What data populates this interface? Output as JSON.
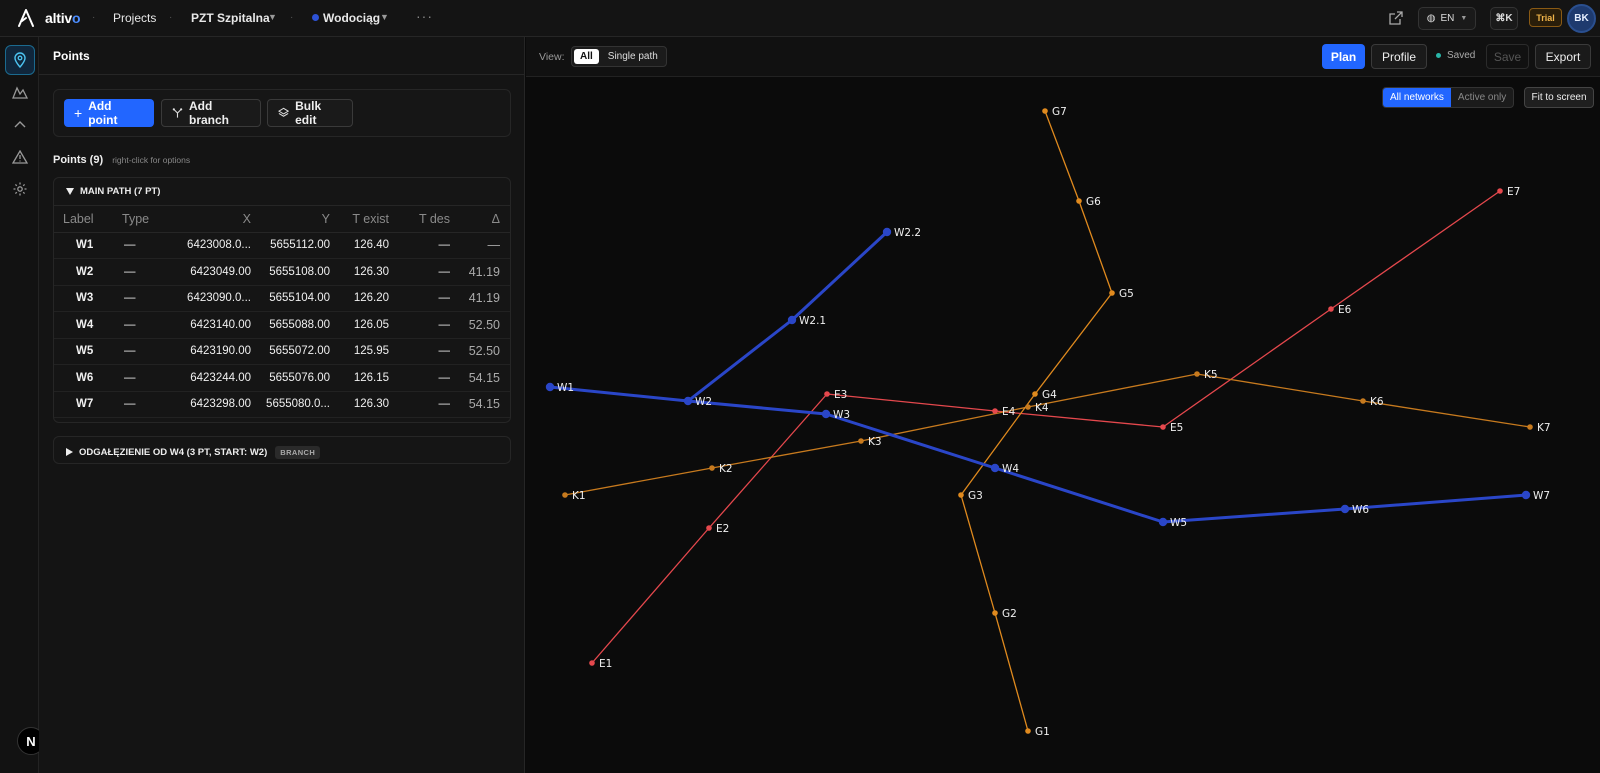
{
  "app": {
    "logo_text": "altiv",
    "logo_accent": "o"
  },
  "breadcrumb": {
    "projects": "Projects",
    "project": "PZT Szpitalna",
    "network": "Wodociąg"
  },
  "topbar": {
    "lang": "EN",
    "shortcut": "⌘K",
    "trial": "Trial",
    "avatar": "BK"
  },
  "rail": {
    "items": [
      "map-pin-icon",
      "terrain-icon",
      "chevron-up-icon",
      "warning-icon",
      "gear-icon"
    ],
    "badge": "N"
  },
  "panel": {
    "title": "Points",
    "add_point": "Add point",
    "add_branch": "Add branch",
    "bulk_edit": "Bulk edit",
    "points_count": "Points (9)",
    "points_hint": "right-click for options",
    "main_group": "MAIN PATH (7 PT)",
    "columns": [
      "Label",
      "Type",
      "X",
      "Y",
      "T exist",
      "T des",
      "Δ"
    ],
    "rows": [
      [
        "W1",
        "—",
        "6423008.0...",
        "5655112.00",
        "126.40",
        "—",
        "—"
      ],
      [
        "W2",
        "—",
        "6423049.00",
        "5655108.00",
        "126.30",
        "—",
        "41.19"
      ],
      [
        "W3",
        "—",
        "6423090.0...",
        "5655104.00",
        "126.20",
        "—",
        "41.19"
      ],
      [
        "W4",
        "—",
        "6423140.00",
        "5655088.00",
        "126.05",
        "—",
        "52.50"
      ],
      [
        "W5",
        "—",
        "6423190.00",
        "5655072.00",
        "125.95",
        "—",
        "52.50"
      ],
      [
        "W6",
        "—",
        "6423244.00",
        "5655076.00",
        "126.15",
        "—",
        "54.15"
      ],
      [
        "W7",
        "—",
        "6423298.00",
        "5655080.0...",
        "126.30",
        "—",
        "54.15"
      ]
    ],
    "branch_group": "ODGAŁĘZIENIE OD W4 (3 PT, START: W2)",
    "branch_tag": "BRANCH"
  },
  "map_header": {
    "view_label": "View:",
    "view_all": "All",
    "view_single": "Single path",
    "plan": "Plan",
    "profile": "Profile",
    "saved": "Saved",
    "save": "Save",
    "export": "Export"
  },
  "map": {
    "all_networks": "All networks",
    "active_only": "Active only",
    "fit": "Fit to screen",
    "colors": {
      "water": "#2a46c8",
      "gas": "#e08a1e",
      "telecom": "#c77a1e",
      "electric": "#e5484d"
    },
    "networks": [
      {
        "name": "W",
        "color": "#2a46c8",
        "width": 3,
        "paths": [
          [
            "W1",
            "W2",
            "W3",
            "W4",
            "W5",
            "W6",
            "W7"
          ],
          [
            "W2",
            "W2.1",
            "W2.2"
          ]
        ]
      },
      {
        "name": "E",
        "color": "#e5484d",
        "width": 1.3,
        "paths": [
          [
            "E1",
            "E2",
            "E3",
            "E4",
            "E5",
            "E6",
            "E7"
          ]
        ]
      },
      {
        "name": "K",
        "color": "#c77a1e",
        "width": 1.3,
        "paths": [
          [
            "K1",
            "K2",
            "K3",
            "K4",
            "K5",
            "K6",
            "K7"
          ]
        ]
      },
      {
        "name": "G",
        "color": "#e08a1e",
        "width": 1.3,
        "paths": [
          [
            "G1",
            "G2",
            "G3",
            "G4",
            "G5",
            "G6",
            "G7"
          ]
        ]
      }
    ]
  }
}
